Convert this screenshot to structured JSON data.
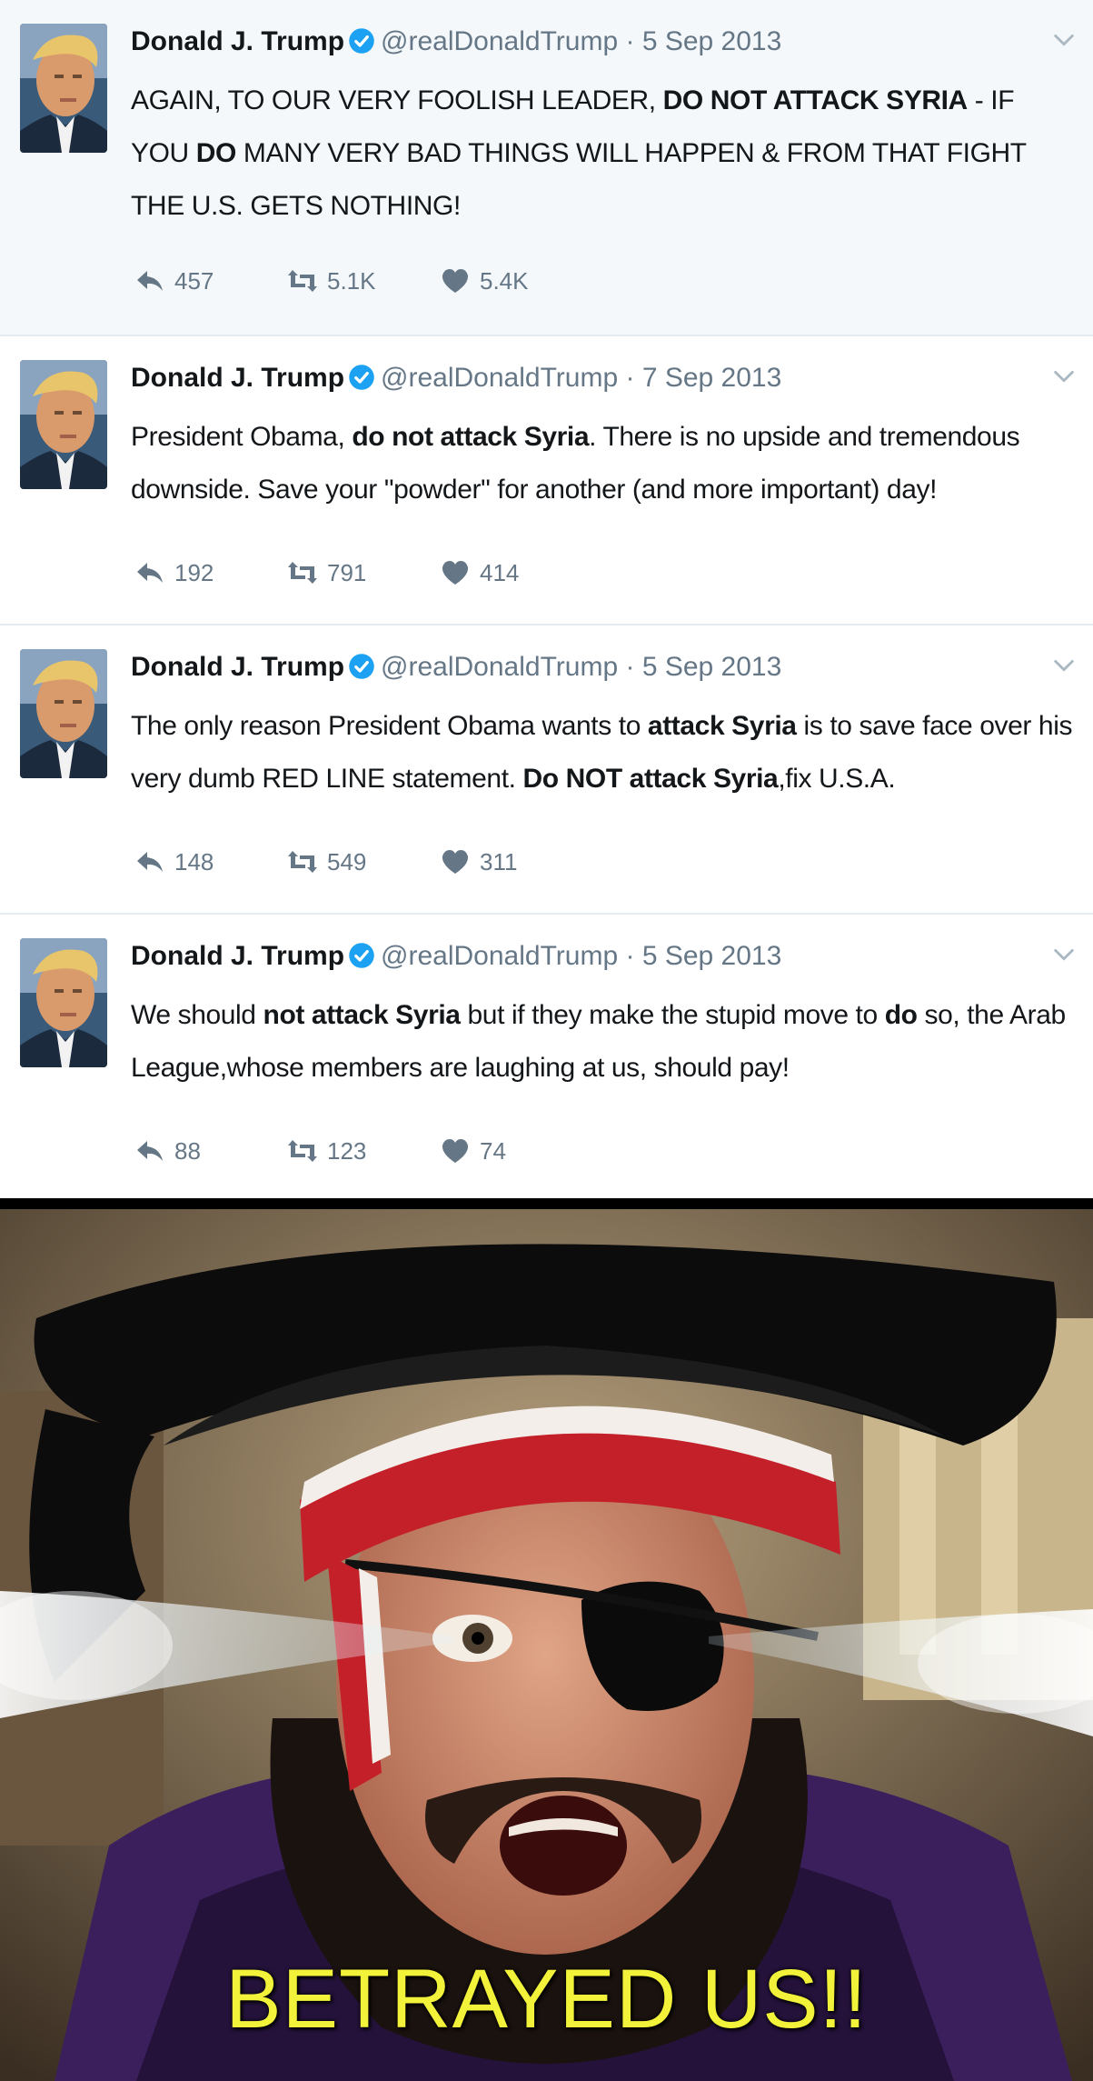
{
  "tweets": [
    {
      "name": "Donald J. Trump",
      "handle": "@realDonaldTrump",
      "separator": "·",
      "date": "5 Sep 2013",
      "text_parts": [
        {
          "t": "AGAIN, TO OUR VERY FOOLISH LEADER, ",
          "bold": false
        },
        {
          "t": "DO NOT ATTACK SYRIA",
          "bold": true
        },
        {
          "t": " - IF YOU ",
          "bold": false
        },
        {
          "t": "DO",
          "bold": true
        },
        {
          "t": " MANY VERY BAD THINGS WILL HAPPEN & FROM THAT FIGHT THE U.S. GETS NOTHING!",
          "bold": false
        }
      ],
      "replies": "457",
      "retweets": "5.1K",
      "likes": "5.4K"
    },
    {
      "name": "Donald J. Trump",
      "handle": "@realDonaldTrump",
      "separator": "·",
      "date": "7 Sep 2013",
      "text_parts": [
        {
          "t": "President Obama, ",
          "bold": false
        },
        {
          "t": "do not attack Syria",
          "bold": true
        },
        {
          "t": ". There is no upside and tremendous downside. Save your \"powder\" for another (and more important) day!",
          "bold": false
        }
      ],
      "replies": "192",
      "retweets": "791",
      "likes": "414"
    },
    {
      "name": "Donald J. Trump",
      "handle": "@realDonaldTrump",
      "separator": "·",
      "date": "5 Sep 2013",
      "text_parts": [
        {
          "t": "The only reason President Obama wants to ",
          "bold": false
        },
        {
          "t": "attack Syria",
          "bold": true
        },
        {
          "t": " is to save face over his very dumb RED LINE statement. ",
          "bold": false
        },
        {
          "t": "Do NOT attack Syria",
          "bold": true
        },
        {
          "t": ",fix U.S.A.",
          "bold": false
        }
      ],
      "replies": "148",
      "retweets": "549",
      "likes": "311"
    },
    {
      "name": "Donald J. Trump",
      "handle": "@realDonaldTrump",
      "separator": "·",
      "date": "5 Sep 2013",
      "text_parts": [
        {
          "t": "We should ",
          "bold": false
        },
        {
          "t": "not attack Syria",
          "bold": true
        },
        {
          "t": " but if they make the stupid move to ",
          "bold": false
        },
        {
          "t": "do",
          "bold": true
        },
        {
          "t": " so, the Arab League,whose members are laughing at us, should pay!",
          "bold": false
        }
      ],
      "replies": "88",
      "retweets": "123",
      "likes": "74"
    }
  ],
  "icons": {
    "verified": "verified-badge-icon",
    "caret": "chevron-down-icon",
    "reply": "reply-icon",
    "retweet": "retweet-icon",
    "like": "heart-icon"
  },
  "colors": {
    "verified_blue": "#1da1f2",
    "meta_gray": "#657786",
    "text_dark": "#14171a",
    "caption_yellow": "#f2f23a"
  },
  "meme": {
    "caption": "BETRAYED US!!"
  }
}
